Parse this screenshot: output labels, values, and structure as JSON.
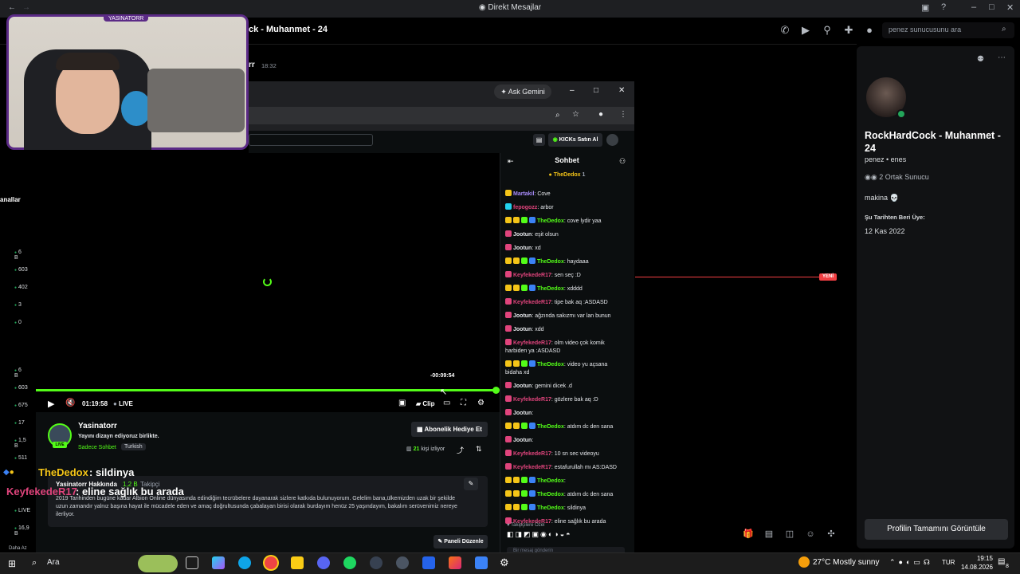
{
  "discord": {
    "window_title": "Direkt Mesajlar",
    "header_title": "ck - Muhanmet - 24",
    "search_placeholder": "penez sunucusunu ara",
    "dm_author": "rr",
    "dm_time": "18:32",
    "new_badge": "YENİ",
    "left_label": "anallar",
    "left_stats": [
      "6 B",
      "603",
      "402",
      "3",
      "0",
      "6 B",
      "603",
      "675",
      "17",
      "1,5 B",
      "511",
      "LIVE",
      "16,9 B"
    ],
    "left_footer": "Daha Az",
    "profile": {
      "name": "RockHardCock - Muhanmet - 24",
      "tag": "penez • enes",
      "mutual": "2 Ortak Sunucu",
      "bio": "makina 💀",
      "member_since_label": "Şu Tarihten Beri Üye:",
      "member_since": "12 Kas 2022",
      "button": "Profilin Tamamını Görüntüle"
    }
  },
  "browser": {
    "gemini_label": "Ask Gemini"
  },
  "kick": {
    "buy_label": "KICKs Satın Al",
    "player": {
      "hover_time": "-00:09:54",
      "time": "01:19:58",
      "live": "LIVE",
      "clip": "Clip",
      "progress": 1.0
    },
    "streamer": {
      "name": "Yasinatorr",
      "live_pill": "LIVE",
      "title": "Yayını dizayn ediyoruz birlikte.",
      "category": "Sadece Sohbet",
      "tag": "Turkish",
      "gift_label": "Abonelik Hediye Et",
      "viewers_count": "21",
      "viewers_label": "kişi izliyor"
    },
    "about": {
      "title": "Yasinatorr Hakkında",
      "followers": "1,2 B",
      "followers_label": "Takipçi",
      "text": "2019 Tarihinden bugüne kadar Albion Online dünyasında edindiğim tecrübelere dayanarak sizlere katkıda bulunuyorum. Gelelim bana,ülkemizden uzak bir şekilde uzun zamandır yalnız başına hayat ile mücadele eden ve amaç doğrultusunda çabalayan birisi olarak burdayım henüz 25 yaşındayım, bakalım serüvenimiz nereye ilerliyor.",
      "edit_label": "Paneli Düzenle"
    },
    "overlay": {
      "user1": "TheDedox",
      "msg1": ": sildinya",
      "user2": "KeyfekedeR17",
      "msg2": ": eline sağlık bu arada"
    },
    "chat": {
      "title": "Sohbet",
      "pinned": "TheDedox",
      "pinned_count": "1",
      "messages": [
        {
          "user": "Martakil",
          "cls": "u-v",
          "badges": [
            "b-y"
          ],
          "text": ": Cove"
        },
        {
          "user": "fepogozz",
          "cls": "u-p",
          "badges": [
            "b-c"
          ],
          "text": ": arbor"
        },
        {
          "user": "TheDedox",
          "cls": "u-g",
          "badges": [
            "b-y",
            "b-y",
            "b-g",
            "b-b"
          ],
          "text": ": cove lydir yaa"
        },
        {
          "user": "Jootun",
          "cls": "u-w",
          "badges": [
            "b-p"
          ],
          "text": ": eşit olsun"
        },
        {
          "user": "Jootun",
          "cls": "u-w",
          "badges": [
            "b-p"
          ],
          "text": ": xd"
        },
        {
          "user": "TheDedox",
          "cls": "u-g",
          "badges": [
            "b-y",
            "b-y",
            "b-g",
            "b-b"
          ],
          "text": ": haydaaa"
        },
        {
          "user": "KeyfekedeR17",
          "cls": "u-p",
          "badges": [
            "b-p"
          ],
          "text": ": sen seç :D"
        },
        {
          "user": "TheDedox",
          "cls": "u-g",
          "badges": [
            "b-y",
            "b-y",
            "b-g",
            "b-b"
          ],
          "text": ": xdddd"
        },
        {
          "user": "KeyfekedeR17",
          "cls": "u-p",
          "badges": [
            "b-p"
          ],
          "text": ": tipe bak aq :ASDASD"
        },
        {
          "user": "Jootun",
          "cls": "u-w",
          "badges": [
            "b-p"
          ],
          "text": ": ağzında sakızmı var lan bunun"
        },
        {
          "user": "Jootun",
          "cls": "u-w",
          "badges": [
            "b-p"
          ],
          "text": ": xdd"
        },
        {
          "user": "KeyfekedeR17",
          "cls": "u-p",
          "badges": [
            "b-p"
          ],
          "text": ": olm video çok komik harbiden ya :ASDASD"
        },
        {
          "user": "TheDedox",
          "cls": "u-g",
          "badges": [
            "b-y",
            "b-y",
            "b-g",
            "b-b"
          ],
          "text": ": video yu açsana bidaha xd"
        },
        {
          "user": "Jootun",
          "cls": "u-w",
          "badges": [
            "b-p"
          ],
          "text": ": gemini dicek .d"
        },
        {
          "user": "KeyfekedeR17",
          "cls": "u-p",
          "badges": [
            "b-p"
          ],
          "text": ": gözlere bak aq :D"
        },
        {
          "user": "Jootun",
          "cls": "u-w",
          "badges": [
            "b-p"
          ],
          "text": ":"
        },
        {
          "user": "TheDedox",
          "cls": "u-g",
          "badges": [
            "b-y",
            "b-y",
            "b-g",
            "b-b"
          ],
          "text": ": atdım dc den sana"
        },
        {
          "user": "Jootun",
          "cls": "u-w",
          "badges": [
            "b-p"
          ],
          "text": ":"
        },
        {
          "user": "KeyfekedeR17",
          "cls": "u-p",
          "badges": [
            "b-p"
          ],
          "text": ": 10 sn sec videoyu"
        },
        {
          "user": "KeyfekedeR17",
          "cls": "u-p",
          "badges": [
            "b-p"
          ],
          "text": ": estafurullah mı AS:DASD"
        },
        {
          "user": "TheDedox",
          "cls": "u-g",
          "badges": [
            "b-y",
            "b-y",
            "b-g",
            "b-b"
          ],
          "text": ":"
        },
        {
          "user": "TheDedox",
          "cls": "u-g",
          "badges": [
            "b-y",
            "b-y",
            "b-g",
            "b-b"
          ],
          "text": ": atdım dc den sana"
        },
        {
          "user": "TheDedox",
          "cls": "u-g",
          "badges": [
            "b-y",
            "b-y",
            "b-g",
            "b-b"
          ],
          "text": ": sildinya"
        },
        {
          "user": "KeyfekedeR17",
          "cls": "u-p",
          "badges": [
            "b-p"
          ],
          "text": ": eline sağlık bu arada"
        }
      ],
      "followers_label": "Takipçilere Özel",
      "input_placeholder": "Bir mesaj gönderin"
    }
  },
  "webcam": {
    "name": "YASINATORR"
  },
  "taskbar": {
    "search": "Ara",
    "weather": "27°C  Mostly sunny",
    "lang": "TUR",
    "time": "19:15",
    "date": "14.08.2026",
    "notif": "8"
  },
  "colors": {
    "kick_green": "#53fc18",
    "discord_online": "#23a55a",
    "new_red": "#f23f43"
  }
}
